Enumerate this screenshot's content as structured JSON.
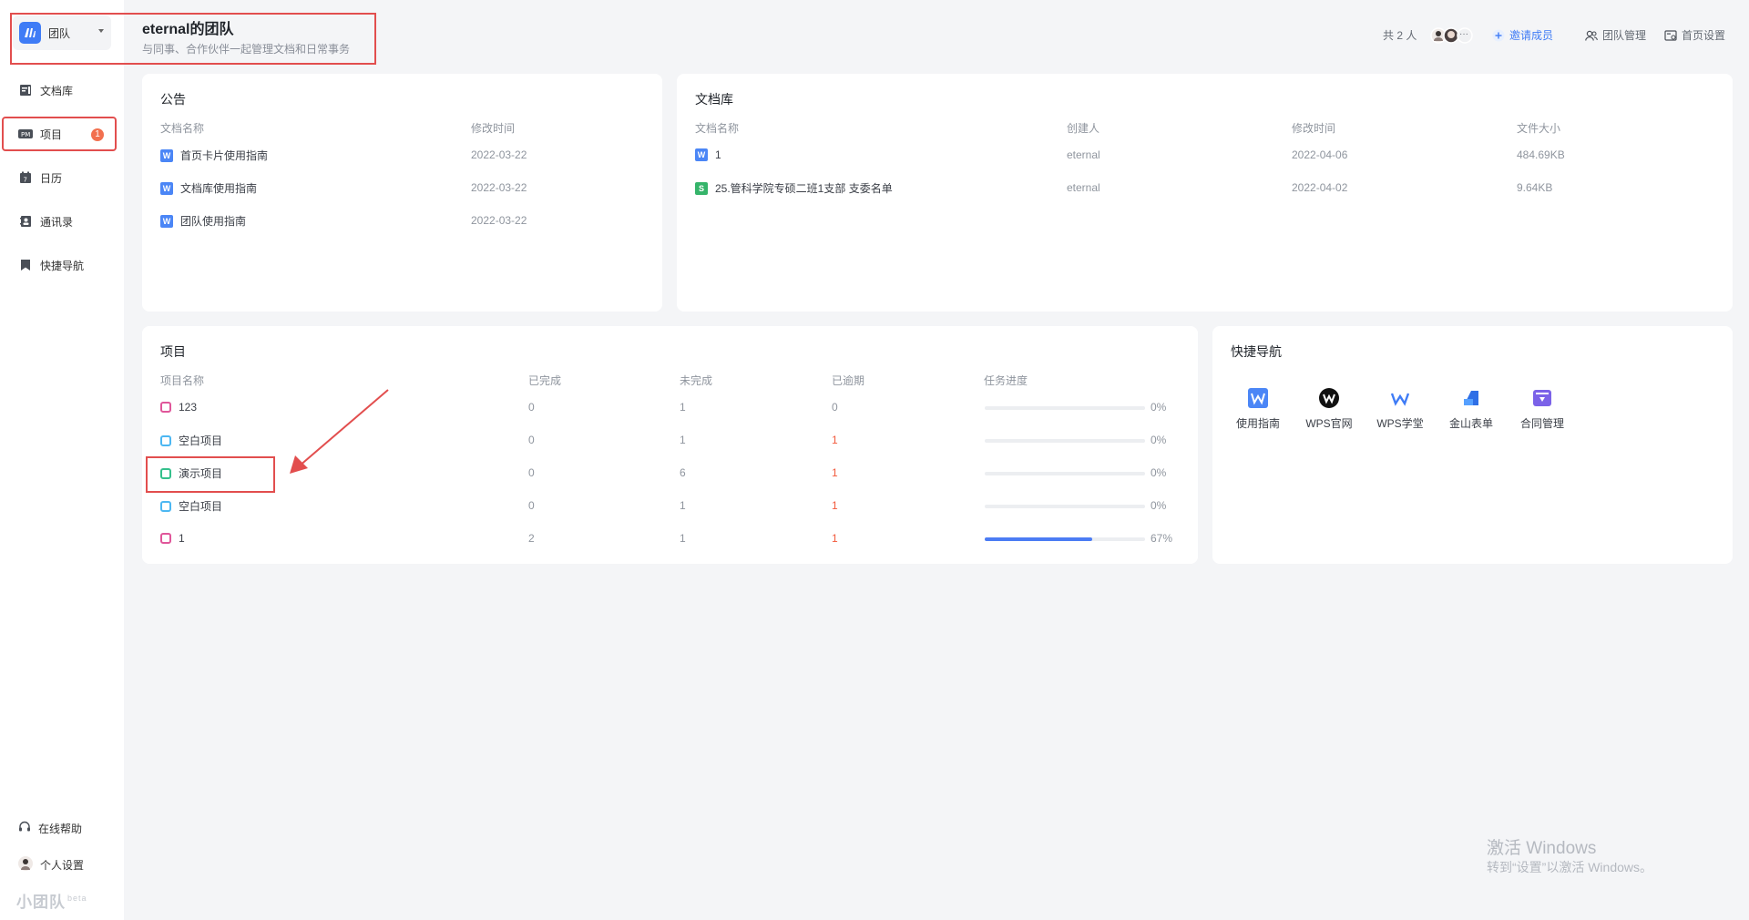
{
  "team": {
    "switch_label": "团队",
    "title": "eternal的团队",
    "subtitle": "与同事、合作伙伴一起管理文档和日常事务"
  },
  "sidebar": {
    "items": [
      {
        "label": "文档库",
        "icon": "library-icon"
      },
      {
        "label": "项目",
        "icon": "project-icon",
        "badge": "1"
      },
      {
        "label": "日历",
        "icon": "calendar-icon"
      },
      {
        "label": "通讯录",
        "icon": "contacts-icon"
      },
      {
        "label": "快捷导航",
        "icon": "bookmark-icon"
      }
    ],
    "footer": [
      {
        "label": "在线帮助",
        "icon": "headset-icon"
      },
      {
        "label": "个人设置",
        "icon": "avatar"
      }
    ],
    "brand": "小团队",
    "brand_tag": "beta"
  },
  "header": {
    "member_count": "共 2 人",
    "more": "···",
    "invite": "邀请成员",
    "team_manage": "团队管理",
    "home_settings": "首页设置"
  },
  "announcement": {
    "title": "公告",
    "columns": [
      "文档名称",
      "修改时间"
    ],
    "rows": [
      {
        "name": "首页卡片使用指南",
        "time": "2022-03-22"
      },
      {
        "name": "文档库使用指南",
        "time": "2022-03-22"
      },
      {
        "name": "团队使用指南",
        "time": "2022-03-22"
      }
    ]
  },
  "library": {
    "title": "文档库",
    "columns": [
      "文档名称",
      "创建人",
      "修改时间",
      "文件大小"
    ],
    "rows": [
      {
        "type": "W",
        "name": "1",
        "creator": "eternal",
        "time": "2022-04-06",
        "size": "484.69KB"
      },
      {
        "type": "S",
        "name": "25.管科学院专硕二班1支部 支委名单",
        "creator": "eternal",
        "time": "2022-04-02",
        "size": "9.64KB"
      }
    ]
  },
  "projects": {
    "title": "项目",
    "columns": [
      "项目名称",
      "已完成",
      "未完成",
      "已逾期",
      "任务进度"
    ],
    "rows": [
      {
        "name": "123",
        "done": "0",
        "todo": "1",
        "overdue": "0",
        "progress": 0,
        "progress_label": "0%",
        "color": "#e0569a"
      },
      {
        "name": "空白项目",
        "done": "0",
        "todo": "1",
        "overdue": "1",
        "progress": 0,
        "progress_label": "0%",
        "color": "#4cb7f2"
      },
      {
        "name": "演示项目",
        "done": "0",
        "todo": "6",
        "overdue": "1",
        "progress": 0,
        "progress_label": "0%",
        "color": "#35c08c"
      },
      {
        "name": "空白项目",
        "done": "0",
        "todo": "1",
        "overdue": "1",
        "progress": 0,
        "progress_label": "0%",
        "color": "#4cb7f2"
      },
      {
        "name": "1",
        "done": "2",
        "todo": "1",
        "overdue": "1",
        "progress": 0.67,
        "progress_label": "67%",
        "color": "#e0569a"
      }
    ]
  },
  "quicknav": {
    "title": "快捷导航",
    "items": [
      {
        "label": "使用指南",
        "icon": "guide-doc-icon"
      },
      {
        "label": "WPS官网",
        "icon": "wps-logo-icon"
      },
      {
        "label": "WPS学堂",
        "icon": "wps-school-icon"
      },
      {
        "label": "金山表单",
        "icon": "form-icon"
      },
      {
        "label": "合同管理",
        "icon": "contract-icon"
      }
    ]
  },
  "watermark": {
    "line1": "激活 Windows",
    "line2": "转到“设置”以激活 Windows。"
  },
  "colors": {
    "accent": "#3f7cf6",
    "overdue": "#f25a3d",
    "highlight_box": "#e24e4e"
  }
}
